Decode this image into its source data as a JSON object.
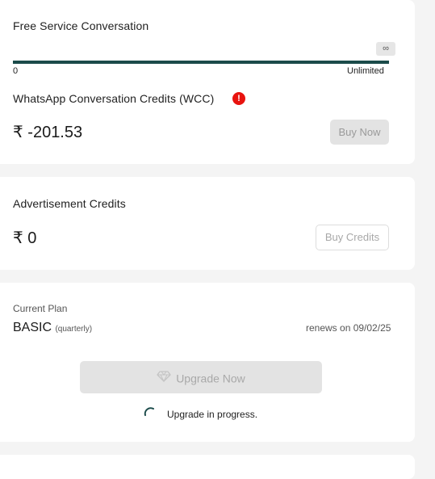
{
  "wallet": {
    "free_service_title": "Free Service Conversation",
    "infinity_symbol": "∞",
    "scale_min": "0",
    "scale_max": "Unlimited",
    "progress_fraction": 1.0,
    "wcc_title": "WhatsApp Conversation Credits (WCC)",
    "warning_symbol": "!",
    "wcc_amount": "₹ -201.53",
    "buy_now_label": "Buy Now"
  },
  "ads": {
    "title": "Advertisement Credits",
    "amount": "₹ 0",
    "buy_credits_label": "Buy Credits"
  },
  "plan": {
    "current_plan_label": "Current Plan",
    "plan_name": "BASIC",
    "plan_period": "(quarterly)",
    "renews_text": "renews on 09/02/25",
    "upgrade_label": "Upgrade Now",
    "progress_text": "Upgrade in progress."
  },
  "colors": {
    "progress_fill": "#1b4b4a",
    "warning": "#e8130f",
    "spinner": "#1b4b4a"
  },
  "icons": {
    "warning": "alert-circle-icon",
    "diamond": "diamond-icon",
    "spinner": "loading-spinner-icon"
  }
}
